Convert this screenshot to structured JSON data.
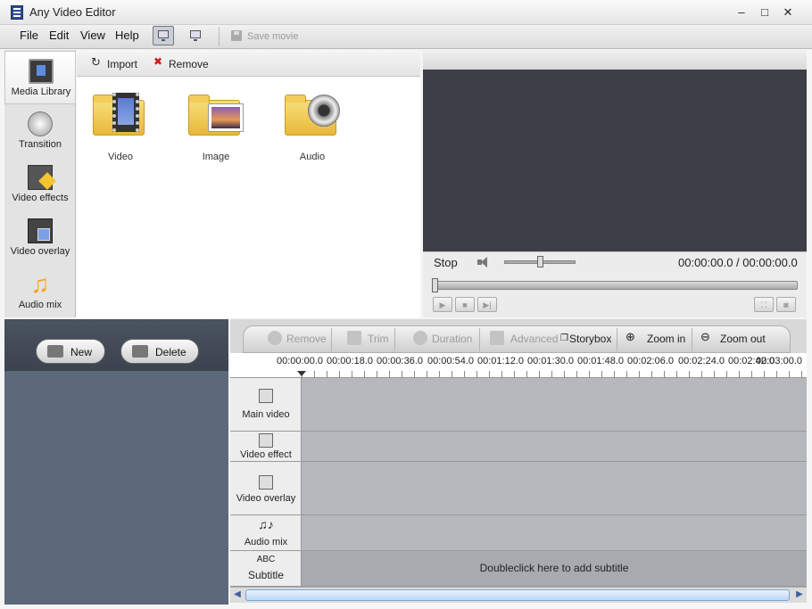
{
  "window": {
    "title": "Any Video Editor",
    "minimize": "–",
    "maximize": "□",
    "close": "✕"
  },
  "menu": {
    "items": [
      "File",
      "Edit",
      "View",
      "Help"
    ],
    "save_movie": "Save movie"
  },
  "sidebar": {
    "items": [
      {
        "label": "Media Library",
        "icon": "film-play-icon"
      },
      {
        "label": "Transition",
        "icon": "transition-icon"
      },
      {
        "label": "Video effects",
        "icon": "video-effects-icon"
      },
      {
        "label": "Video overlay",
        "icon": "video-overlay-icon"
      },
      {
        "label": "Audio mix",
        "icon": "music-note-icon"
      }
    ]
  },
  "library": {
    "import": "Import",
    "remove": "Remove",
    "tiles": [
      {
        "label": "Video"
      },
      {
        "label": "Image"
      },
      {
        "label": "Audio"
      }
    ]
  },
  "preview": {
    "status": "Stop",
    "time": "00:00:00.0 / 00:00:00.0",
    "volume": 0.5
  },
  "project": {
    "new": "New",
    "delete": "Delete"
  },
  "timeline": {
    "tools": {
      "remove": "Remove",
      "trim": "Trim",
      "duration": "Duration",
      "advanced": "Advanced",
      "storybox": "Storybox",
      "zoom_in": "Zoom in",
      "zoom_out": "Zoom out"
    },
    "ticks": [
      "00:00:00.0",
      "00:00:18.0",
      "00:00:36.0",
      "00:00:54.0",
      "00:01:12.0",
      "00:01:30.0",
      "00:01:48.0",
      "00:02:06.0",
      "00:02:24.0",
      "00:02:42.0",
      "00:03:00.0"
    ],
    "tracks": {
      "main_video": "Main video",
      "video_effect": "Video effect",
      "video_overlay": "Video overlay",
      "audio_mix": "Audio mix",
      "subtitle_abc": "ABC",
      "subtitle": "Subtitle"
    },
    "subtitle_hint": "Doubleclick here to add subtitle"
  },
  "colors": {
    "preview_bg": "#3e3f46",
    "track_bg": "#b7b8bd",
    "panel_dark": "#5c6978"
  }
}
